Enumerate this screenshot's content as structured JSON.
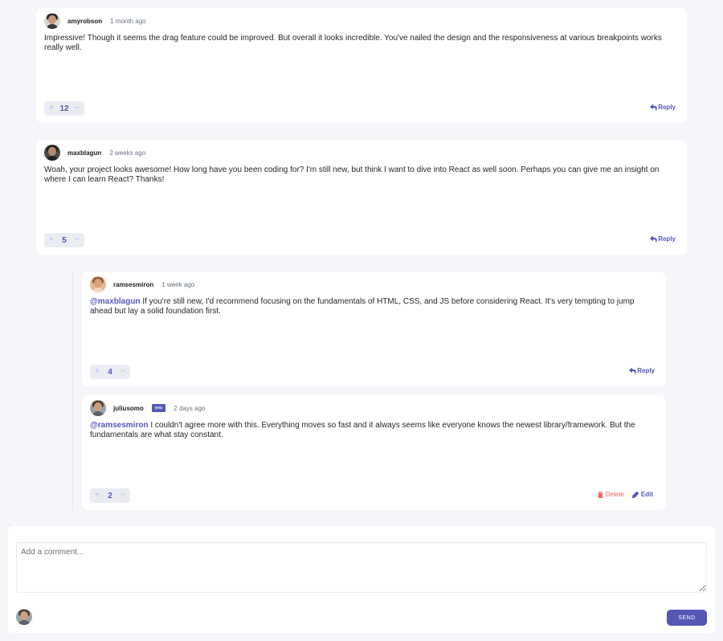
{
  "comments": [
    {
      "username": "amyrobson",
      "time": "1 month ago",
      "text": "Impressive! Though it seems the drag feature could be improved. But overall it looks incredible. You've nailed the design and the responsiveness at various breakpoints works really well.",
      "score": "12",
      "reply_label": "Reply"
    },
    {
      "username": "maxblagun",
      "time": "2 weeks ago",
      "text": "Woah, your project looks awesome! How long have you been coding for? I'm still new, but think I want to dive into React as well soon. Perhaps you can give me an insight on where I can learn React? Thanks!",
      "score": "5",
      "reply_label": "Reply"
    }
  ],
  "replies": [
    {
      "username": "ramsesmiron",
      "time": "1 week ago",
      "mention": "@maxblagun",
      "text": " If you're still new, I'd recommend focusing on the fundamentals of HTML, CSS, and JS before considering React. It's very tempting to jump ahead but lay a solid foundation first.",
      "score": "4",
      "reply_label": "Reply"
    },
    {
      "username": "juliusomo",
      "badge": "you",
      "time": "2 days ago",
      "mention": "@ramsesmiron",
      "text": " I couldn't agree more with this. Everything moves so fast and it always seems like everyone knows the newest library/framework. But the fundamentals are what stay constant.",
      "score": "2",
      "delete_label": "Delete",
      "edit_label": "Edit"
    }
  ],
  "compose": {
    "placeholder": "Add a comment...",
    "send_label": "SEND"
  },
  "vote": {
    "plus": "+",
    "minus": "−"
  },
  "colors": {
    "accent": "#5457b6",
    "danger": "#ed6468",
    "background": "#f5f6fa",
    "vote_bg": "#eaecf1"
  },
  "icons": [
    "reply-icon",
    "delete-icon",
    "edit-icon",
    "avatar"
  ]
}
